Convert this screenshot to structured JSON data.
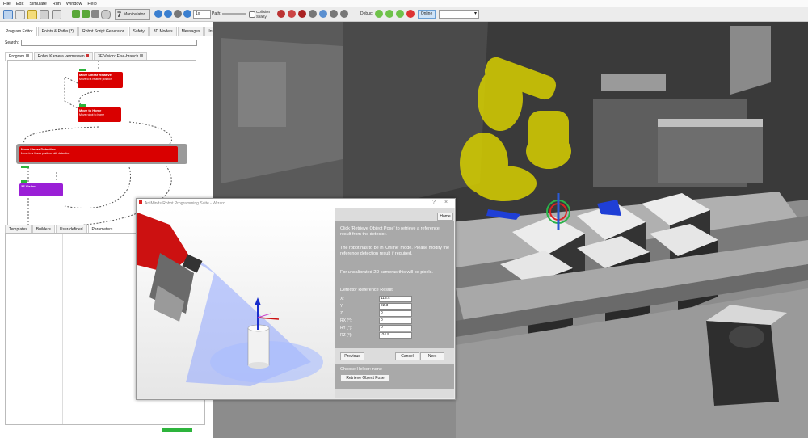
{
  "menu": [
    "File",
    "Edit",
    "Simulate",
    "Run",
    "Window",
    "Help"
  ],
  "toolbar": {
    "manipulator_label": "Manipulator",
    "step_value": "1x",
    "path_label": "Path:",
    "collision_label": "Collision",
    "safety_label": "Safety",
    "debug_label": "Debug:",
    "online_label": "Online"
  },
  "left_panel": {
    "top_tabs": [
      "Program Editor",
      "Points & Paths (*)",
      "Robot Script Generator",
      "Safety",
      "3D Models",
      "Messages",
      "Information"
    ],
    "search_label": "Search:",
    "doc_tabs": [
      "Program",
      "Robot Kamera vermessen",
      "3F Vision: Else-branch"
    ],
    "nodes": [
      {
        "title": "Move Linear Relative",
        "desc": "Move to a relative position"
      },
      {
        "title": "Move to Home",
        "desc": "Move robot to home"
      },
      {
        "title": "Move Linear Detection",
        "desc": "Move to a linear position with detection"
      },
      {
        "title": "3F Vision",
        "desc": ""
      }
    ],
    "bottom_tabs": [
      "Templates",
      "Builders",
      "User-defined",
      "Parameters"
    ]
  },
  "dialog": {
    "title": "ArtiMinds Robot Programming Suite - Wizard",
    "home_label": "Home",
    "instructions": [
      "Click 'Retrieve Object Pose' to retrieve a reference result from the detector.",
      "The robot has to be in 'Online' mode. Please modify the reference detection result if required.",
      "For uncalibrated 2D cameras this will be pixels."
    ],
    "result_heading": "Detector Reference Result:",
    "fields": [
      {
        "label": "X:",
        "value": "113.4"
      },
      {
        "label": "Y:",
        "value": "22.3"
      },
      {
        "label": "Z:",
        "value": "0"
      },
      {
        "label": "RX (°):",
        "value": "0"
      },
      {
        "label": "RY (°):",
        "value": "0"
      },
      {
        "label": "RZ (°):",
        "value": "-24.9"
      }
    ],
    "previous_label": "Previous",
    "cancel_label": "Cancel",
    "next_label": "Next",
    "helper_label": "Choose Helper: none",
    "retrieve_label": "Retrieve Object Pose"
  },
  "colors": {
    "node_red": "#d90000",
    "node_purple": "#9a1fd6",
    "robot_yellow": "#d8d000",
    "accent_green": "#2db43c"
  }
}
